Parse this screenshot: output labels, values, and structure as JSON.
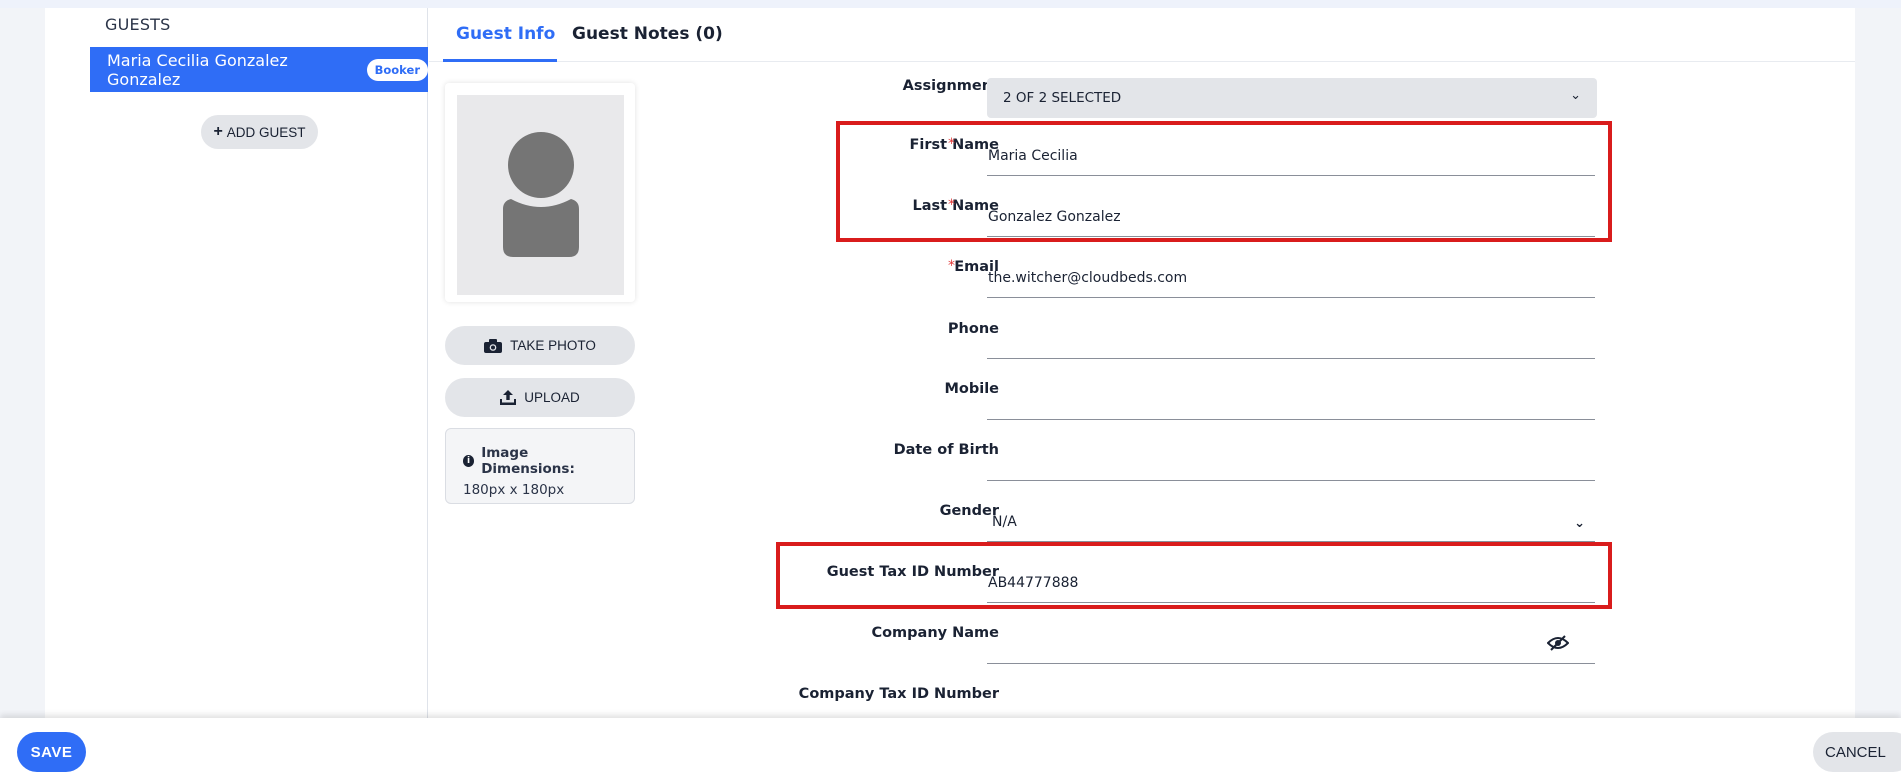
{
  "sidebar": {
    "heading": "GUESTS",
    "guest_name": "Maria Cecilia Gonzalez Gonzalez",
    "booker_badge": "Booker",
    "add_guest_label": "ADD GUEST"
  },
  "tabs": {
    "guest_info": "Guest Info",
    "guest_notes": "Guest Notes (0)"
  },
  "photo": {
    "take_photo_label": "TAKE PHOTO",
    "upload_label": "UPLOAD",
    "dimensions_title": "Image Dimensions:",
    "dimensions_value": "180px x 180px"
  },
  "form": {
    "assignment": {
      "label": "Assignment",
      "value": "2 OF 2 SELECTED"
    },
    "first_name": {
      "label": "First Name",
      "value": "Maria Cecilia",
      "required": "*"
    },
    "last_name": {
      "label": "Last Name",
      "value": "Gonzalez Gonzalez",
      "required": "*"
    },
    "email": {
      "label": "Email",
      "value": "the.witcher@cloudbeds.com",
      "required": "*"
    },
    "phone": {
      "label": "Phone",
      "value": ""
    },
    "mobile": {
      "label": "Mobile",
      "value": ""
    },
    "date_of_birth": {
      "label": "Date of Birth",
      "value": ""
    },
    "gender": {
      "label": "Gender",
      "value": "N/A"
    },
    "guest_tax_id": {
      "label": "Guest Tax ID Number",
      "value": "AB44777888"
    },
    "company_name": {
      "label": "Company Name",
      "value": ""
    },
    "company_tax_id": {
      "label": "Company Tax ID Number"
    }
  },
  "footer": {
    "save_label": "SAVE",
    "cancel_label": "CANCEL"
  },
  "colors": {
    "accent": "#2f6df6",
    "highlight_box": "#d91c1c",
    "required": "#e03b3b"
  }
}
